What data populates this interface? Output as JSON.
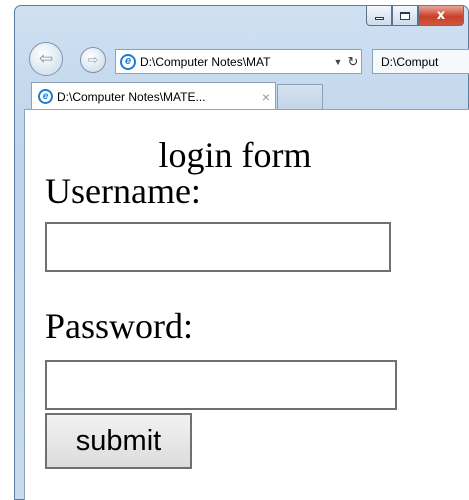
{
  "window": {
    "caption_buttons": {
      "minimize_icon": "minimize-icon",
      "maximize_icon": "maximize-icon",
      "close_label": "x"
    }
  },
  "toolbar": {
    "back_icon": "back-arrow-icon",
    "forward_icon": "forward-arrow-icon",
    "address": "D:\\Computer Notes\\MAT",
    "address_tab": "D:\\Comput"
  },
  "tabs": [
    {
      "label": "D:\\Computer Notes\\MATE...",
      "close": "×"
    }
  ],
  "page": {
    "title": "login form",
    "username_label": "Username:",
    "username_value": "",
    "password_label": "Password:",
    "password_value": "",
    "submit_label": "submit"
  },
  "colors": {
    "accent_red": "#e2141c",
    "window_frame": "#bcd3ea",
    "close_button": "#c7402a"
  }
}
